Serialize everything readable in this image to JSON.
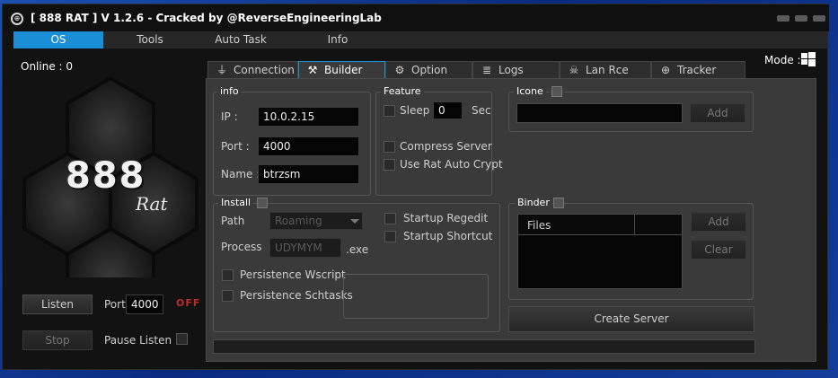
{
  "window": {
    "logo_glyph": "⊕",
    "title": "[ 888 RAT ] V 1.2.6 - Cracked by @ReverseEngineeringLab"
  },
  "menu": [
    "OS",
    "Tools",
    "Auto Task",
    "Info"
  ],
  "left": {
    "online": "Online : 0",
    "logo_text": "888",
    "logo_sub": "Rat",
    "listen_label": "Listen",
    "port_label": "Port",
    "port_value": "4000",
    "status": "OFF",
    "stop_label": "Stop",
    "pause_label": "Pause Listen"
  },
  "mode_label": "Mode :",
  "tabs": [
    {
      "label": "Connection",
      "icon": "plug-icon",
      "glyph": "⏚"
    },
    {
      "label": "Builder",
      "icon": "tools-icon",
      "glyph": "⚒"
    },
    {
      "label": "Option",
      "icon": "gear-icon",
      "glyph": "⚙"
    },
    {
      "label": "Logs",
      "icon": "database-icon",
      "glyph": "≣"
    },
    {
      "label": "Lan Rce",
      "icon": "skull-icon",
      "glyph": "☠"
    },
    {
      "label": "Tracker",
      "icon": "globe-icon",
      "glyph": "⊕"
    }
  ],
  "info": {
    "title": "info",
    "ip_label": "IP :",
    "ip_value": "10.0.2.15",
    "port_label": "Port :",
    "port_value": "4000",
    "name_label": "Name :",
    "name_value": "btrzsm"
  },
  "feature": {
    "title": "Feature",
    "sleep_label": "Sleep",
    "sleep_value": "0",
    "sec_label": "Sec",
    "compress_label": "Compress Server",
    "autocrypt_label": "Use Rat Auto Crypt"
  },
  "icone": {
    "title": "Icone",
    "add_label": "Add"
  },
  "install": {
    "title": "Install",
    "path_label": "Path",
    "path_value": "Roaming",
    "process_label": "Process",
    "process_value": "UDYMYM",
    "ext": ".exe",
    "regedit_label": "Startup Regedit",
    "shortcut_label": "Startup Shortcut",
    "wscript_label": "Persistence Wscript",
    "schtasks_label": "Persistence Schtasks"
  },
  "binder": {
    "title": "Binder",
    "files_header": "Files",
    "add_label": "Add",
    "clear_label": "Clear"
  },
  "create_label": "Create Server",
  "colors": {
    "accent": "#1b8fd6",
    "status_off": "#c0282a",
    "desktop": "#1b4fb0"
  }
}
